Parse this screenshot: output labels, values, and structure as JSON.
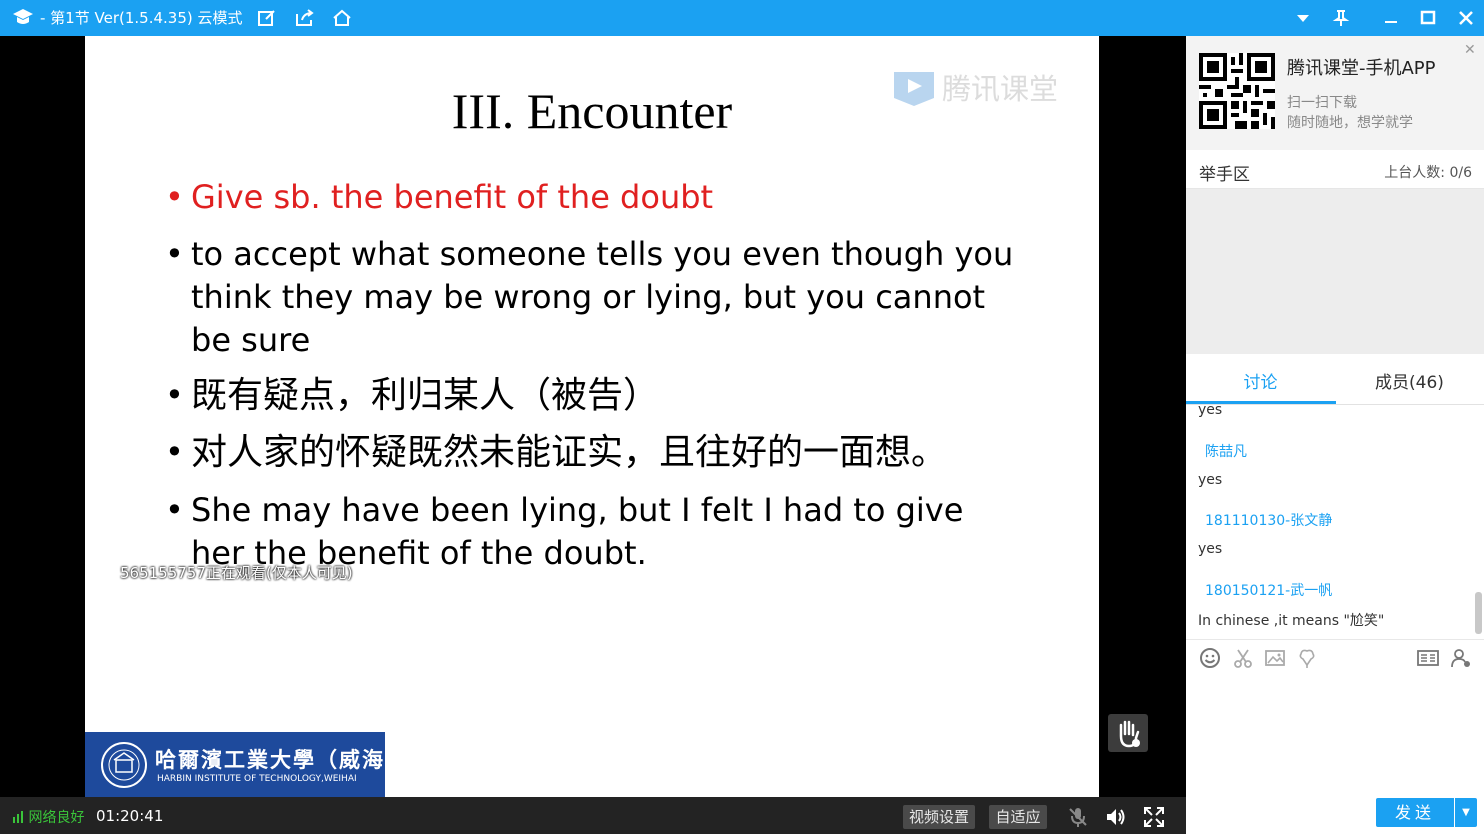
{
  "titlebar": {
    "title": "- 第1节 Ver(1.5.4.35)  云模式",
    "icons": [
      "edit-icon",
      "share-icon",
      "home-icon"
    ],
    "window_buttons": [
      "dropdown-icon",
      "pin-icon",
      "minimize-icon",
      "maximize-icon",
      "close-icon"
    ]
  },
  "slide": {
    "watermark": "腾讯课堂",
    "title": "III. Encounter",
    "bullets": [
      {
        "text": "Give sb. the benefit of the doubt",
        "color": "#e02020"
      },
      {
        "text": "to accept what someone tells you even though you think they may be wrong or lying, but you cannot be sure"
      },
      {
        "text": "既有疑点，利归某人（被告）"
      },
      {
        "text": "对人家的怀疑既然未能证实，且往好的一面想。"
      },
      {
        "text": "She may have been lying, but I felt I had to give her the benefit of the doubt."
      }
    ],
    "viewer_notice": "565155757正在观看(仅本人可见)",
    "logo_cn": "哈爾濱工業大學（威海）",
    "logo_en": "HARBIN INSTITUTE OF TECHNOLOGY,WEIHAI"
  },
  "bottombar": {
    "network": "网络良好",
    "time": "01:20:41",
    "video_settings": "视频设置",
    "auto_fit": "自适应"
  },
  "sidebar": {
    "app_title": "腾讯课堂-手机APP",
    "scan_text": "扫一扫下载",
    "slogan": "随时随地，想学就学",
    "raise_hand_label": "举手区",
    "stage_count": "上台人数: 0/6",
    "tabs": [
      {
        "label": "讨论",
        "active": true
      },
      {
        "label": "成员(46)",
        "active": false
      }
    ],
    "messages": [
      {
        "name": "",
        "text": "yes"
      },
      {
        "name": "陈喆凡",
        "text": "yes"
      },
      {
        "name": "181110130-张文静",
        "text": "yes"
      },
      {
        "name": "180150121-武一帆",
        "text": "In chinese ,it means \"尬笑\""
      }
    ],
    "send_label": "发送",
    "accent": "#1ba1f2"
  }
}
